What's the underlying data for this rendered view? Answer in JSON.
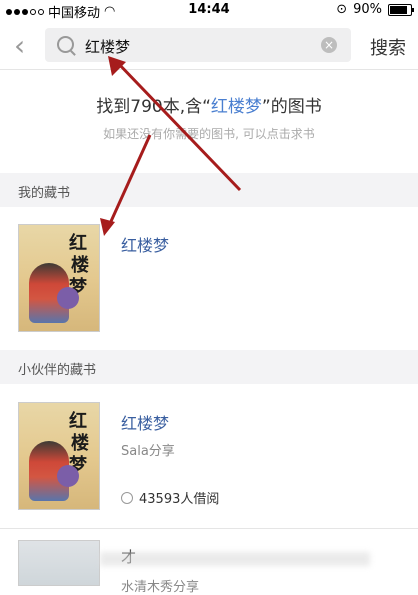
{
  "statusbar": {
    "carrier": "中国移动",
    "time": "14:44",
    "battery": "90%"
  },
  "search": {
    "query": "红楼梦",
    "button": "搜索"
  },
  "result": {
    "prefix": "找到790本,含“",
    "keyword": "红楼梦",
    "suffix": "”的图书",
    "hint": "如果还没有你需要的图书, 可以点击求书"
  },
  "sections": {
    "mine": {
      "label": "我的藏书",
      "books": [
        {
          "title": "红楼梦"
        }
      ]
    },
    "friends": {
      "label": "小伙伴的藏书",
      "books": [
        {
          "title": "红楼梦",
          "owner": "Sala分享",
          "borrow": "43593人借阅"
        },
        {
          "title": "才",
          "owner": "水清木秀分享"
        }
      ]
    }
  }
}
